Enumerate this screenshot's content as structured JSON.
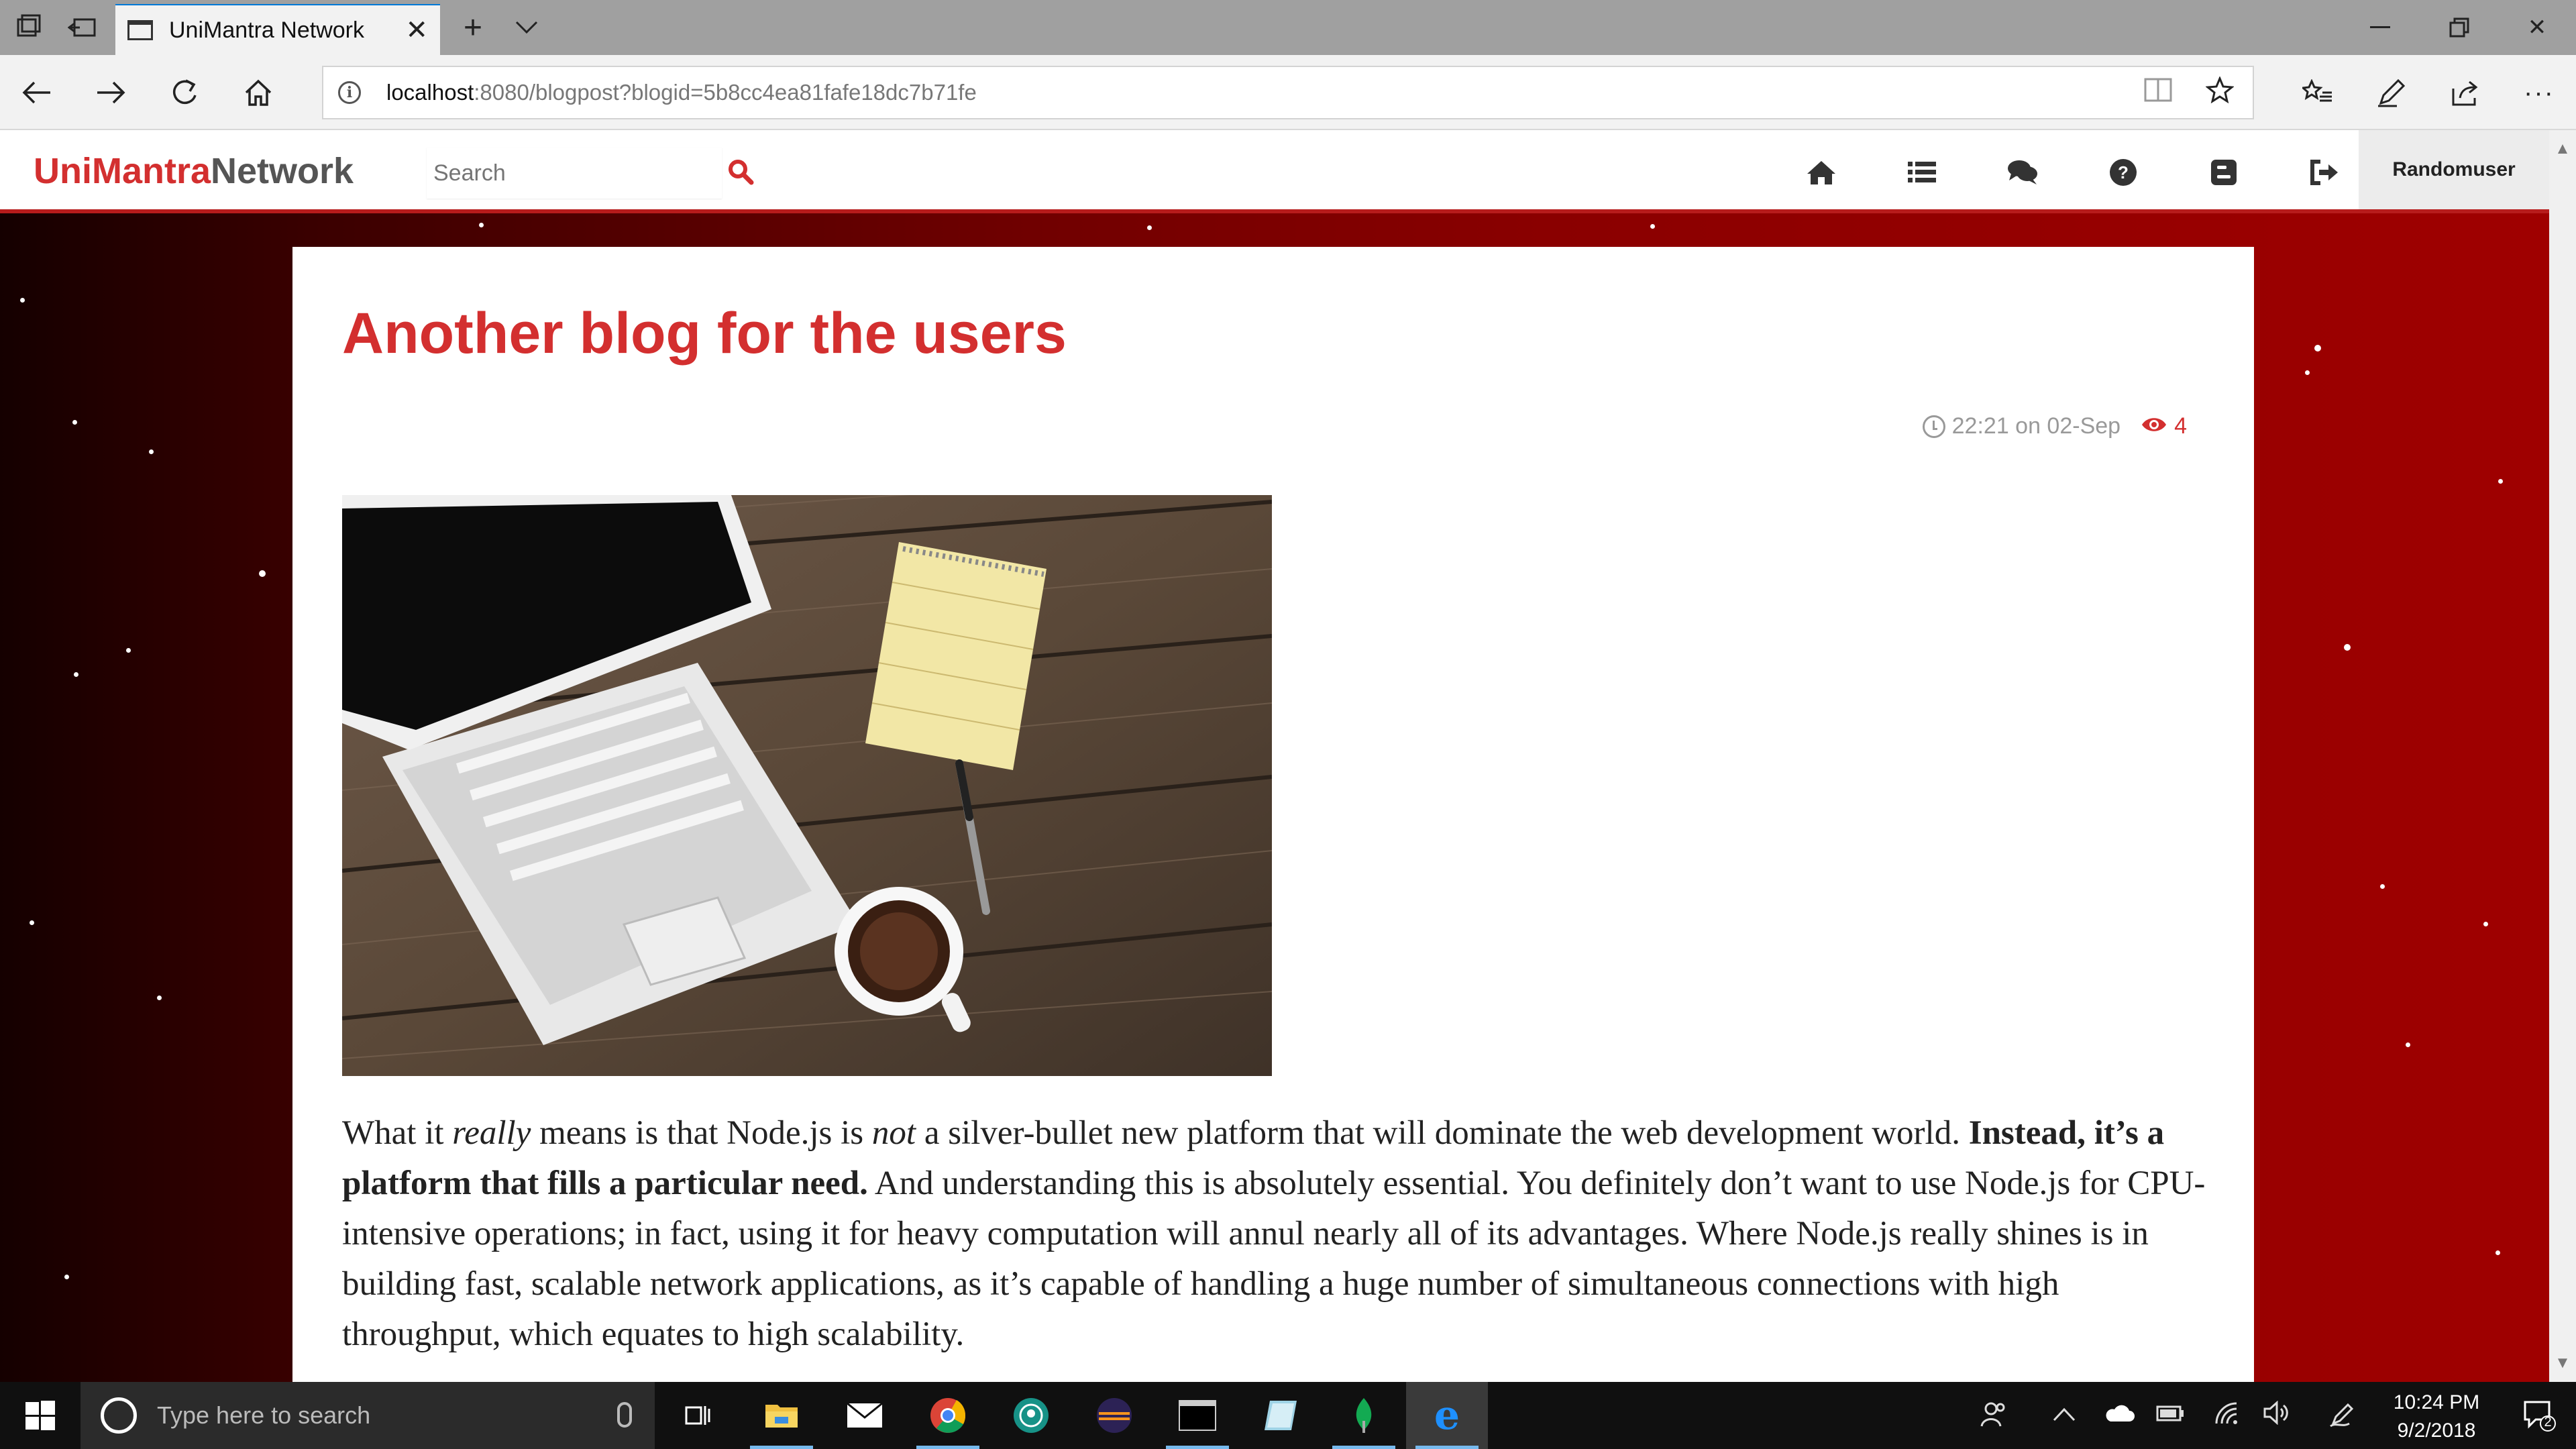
{
  "browser": {
    "tab_title": "UniMantra Network",
    "url_host": "localhost",
    "url_rest": ":8080/blogpost?blogid=5b8cc4ea81fafe18dc7b71fe"
  },
  "site": {
    "brand_part1": "UniMantra",
    "brand_part2": "Network",
    "search_placeholder": "Search",
    "username": "Randomuser",
    "nav_icons": [
      "home-icon",
      "list-icon",
      "comments-icon",
      "question-icon",
      "blog-icon",
      "logout-icon"
    ],
    "accent": "#d32f2f"
  },
  "post": {
    "title": "Another blog for the users",
    "time": "22:21 on 02-Sep",
    "views": "4",
    "image_description": "",
    "body": {
      "p1": "What it ",
      "em1": "really",
      "p2": " means is that Node.js is ",
      "em2": "not",
      "p3": " a silver-bullet new platform that will dominate the web development world. ",
      "strong1": "Instead, it’s a platform that fills a particular need.",
      "p4": " And understanding this is absolutely essential. You definitely don’t want to use Node.js for CPU-intensive operations; in fact, using it for heavy computation will annul nearly all of its advantages. Where Node.js really shines is in building fast, scalable network applications, as it’s capable of handling a huge number of simultaneous connections with high throughput, which equates to high scalability."
    }
  },
  "taskbar": {
    "search_placeholder": "Type here to search",
    "time": "10:24 PM",
    "date": "9/2/2018",
    "notification_count": "2"
  }
}
